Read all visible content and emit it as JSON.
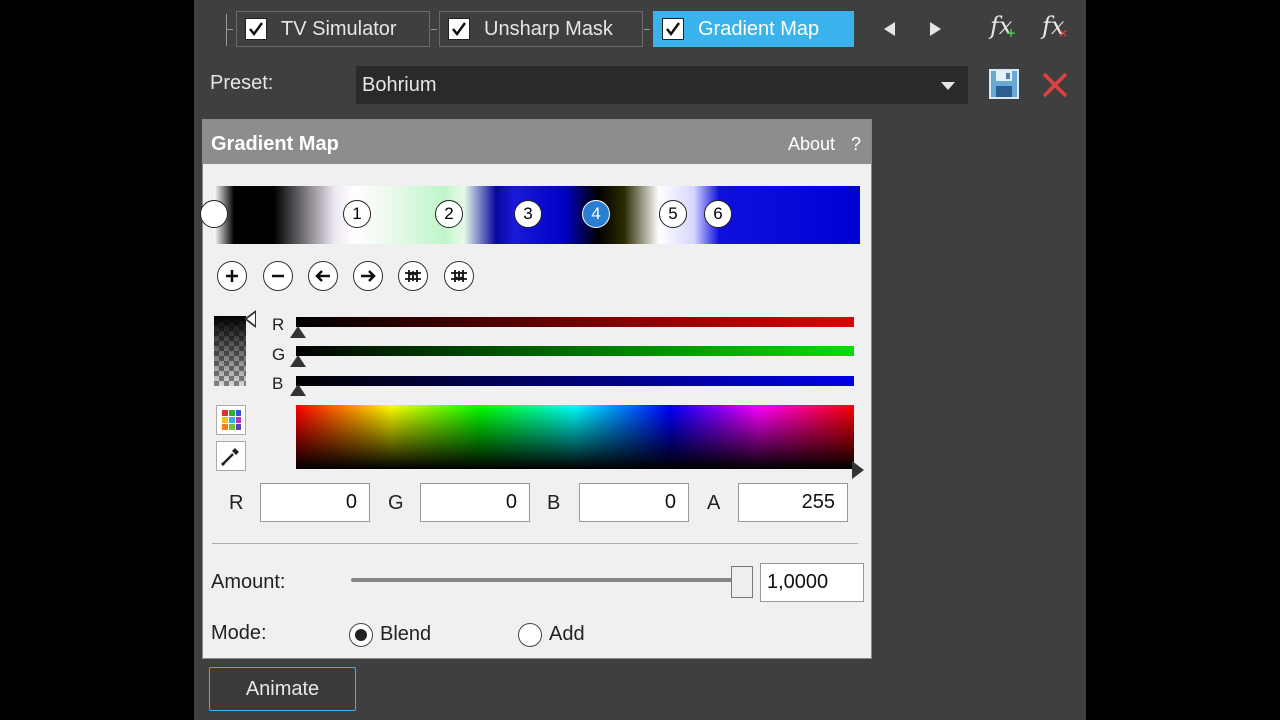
{
  "tabs": [
    {
      "label": "TV Simulator",
      "checked": true,
      "active": false
    },
    {
      "label": "Unsharp Mask",
      "checked": true,
      "active": false
    },
    {
      "label": "Gradient Map",
      "checked": true,
      "active": true
    }
  ],
  "icons": {
    "nav_prev": "triangle-left-icon",
    "nav_next": "triangle-right-icon",
    "fx_add": "fx-add-icon",
    "fx_remove": "fx-remove-icon",
    "save": "floppy-disk-icon",
    "delete": "red-x-icon"
  },
  "preset": {
    "label": "Preset:",
    "value": "Bohrium"
  },
  "dialog": {
    "title": "Gradient Map",
    "about": "About",
    "help": "?",
    "stops": [
      "1",
      "2",
      "3",
      "4",
      "5",
      "6"
    ],
    "selected_stop": "4",
    "channels": [
      "R",
      "G",
      "B"
    ],
    "fields": [
      {
        "label": "R",
        "value": "0"
      },
      {
        "label": "G",
        "value": "0"
      },
      {
        "label": "B",
        "value": "0"
      },
      {
        "label": "A",
        "value": "255"
      }
    ],
    "amount": {
      "label": "Amount:",
      "value": "1,0000",
      "level": 1.0
    },
    "mode": {
      "label": "Mode:",
      "options": [
        "Blend",
        "Add"
      ],
      "selected": "Blend"
    }
  },
  "animate_label": "Animate",
  "colors": {
    "accent": "#3ab2ec",
    "panel": "#3f3f3f",
    "delete_red": "#e04040"
  }
}
